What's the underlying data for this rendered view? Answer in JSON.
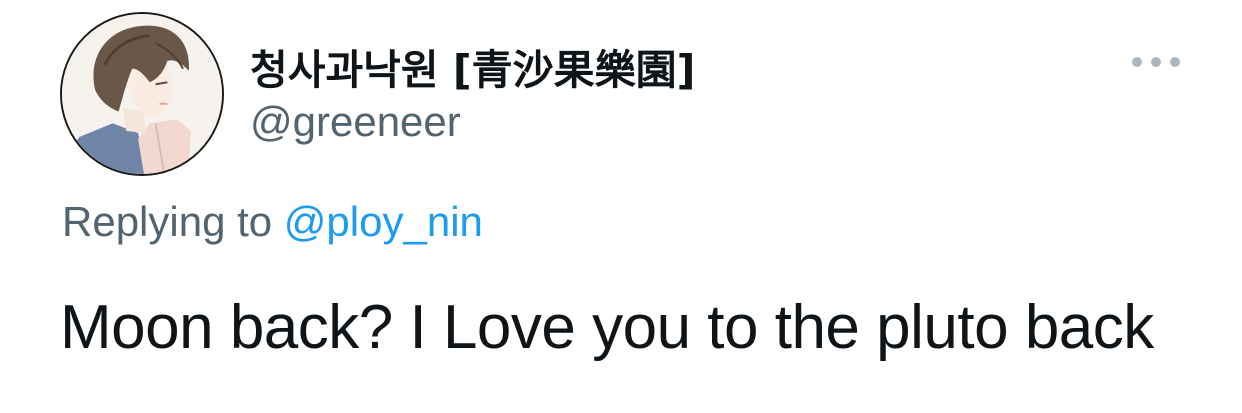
{
  "tweet": {
    "author": {
      "display_name": "청사과낙원 [青沙果樂園]",
      "handle": "@greeneer",
      "avatar_icon": "avatar-illustration"
    },
    "more_menu_icon": "more-horizontal-icon",
    "reply_context": {
      "prefix": "Replying to",
      "mention": "@ploy_nin"
    },
    "text": "Moon back? I Love you to the pluto back"
  },
  "colors": {
    "text_primary": "#0f1419",
    "text_secondary": "#536471",
    "accent_link": "#1d9bf0",
    "more_dots": "#aab8c2"
  }
}
